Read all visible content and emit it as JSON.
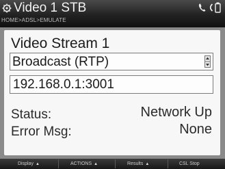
{
  "titlebar": {
    "title": "Video 1 STB",
    "breadcrumb": "HOME>ADSL>EMULATE"
  },
  "stream": {
    "title": "Video Stream 1",
    "mode_value": "Broadcast (RTP)",
    "address_value": "192.168.0.1:3001"
  },
  "status": {
    "status_label": "Status:",
    "status_value": "Network Up",
    "error_label": "Error Msg:",
    "error_value": "None"
  },
  "softkeys": [
    {
      "label": "Display",
      "arrow": "▲"
    },
    {
      "label": "ACTIONS",
      "arrow": "▲"
    },
    {
      "label": "Results",
      "arrow": "▲"
    },
    {
      "label": "CSL Stop"
    }
  ],
  "icons": {
    "title_icon": "gear-icon",
    "phone_icon": "phone-icon",
    "battery_icon": "battery-icon"
  }
}
